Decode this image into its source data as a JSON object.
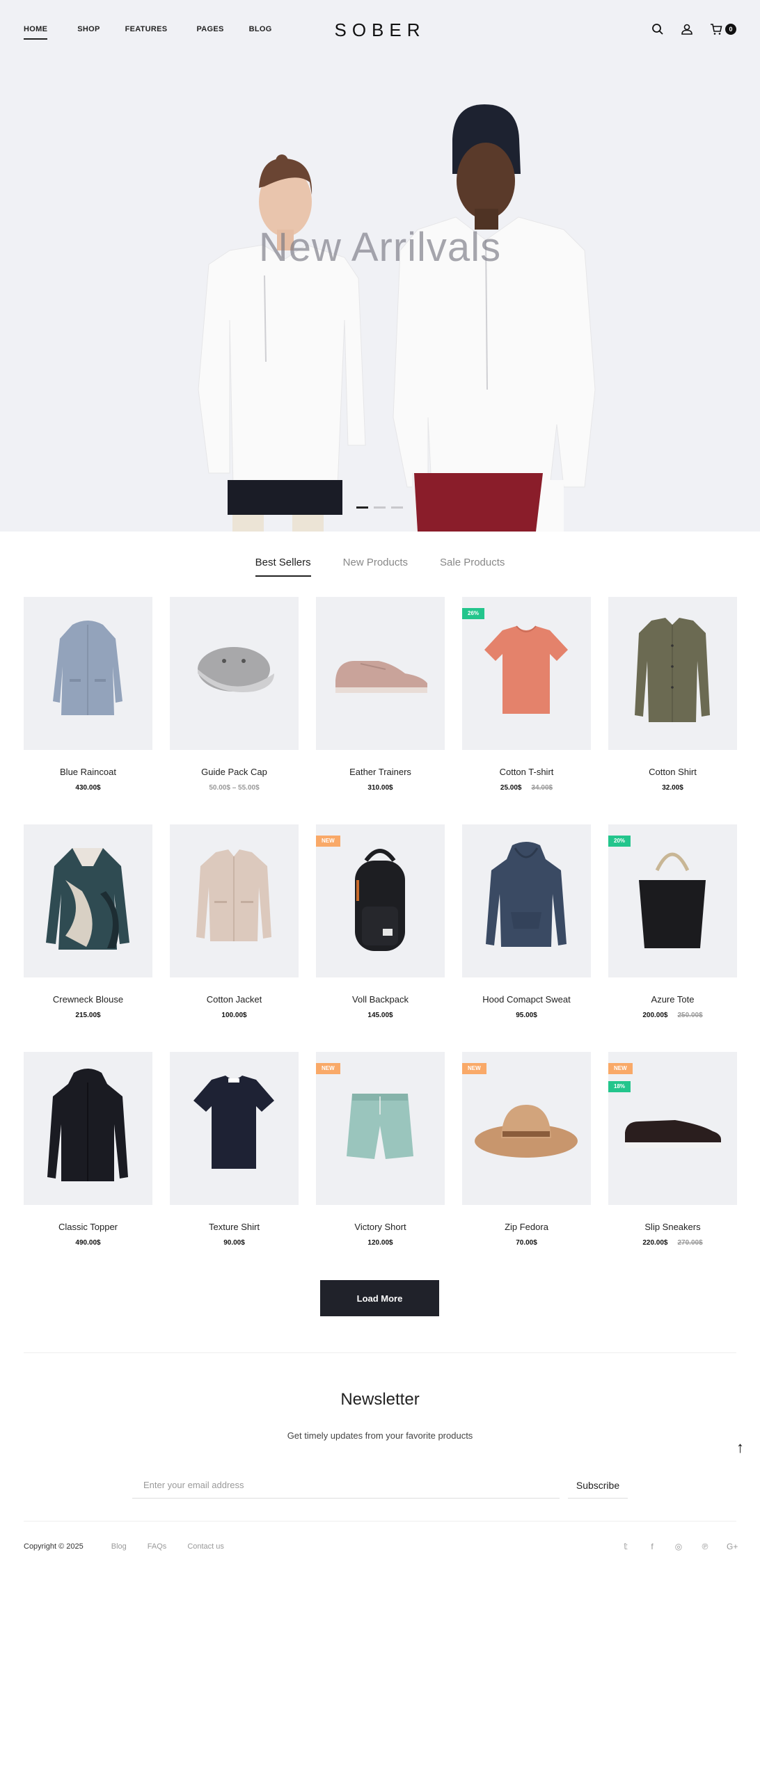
{
  "header": {
    "nav": [
      "HOME",
      "SHOP",
      "FEATURES",
      "PAGES",
      "BLOG"
    ],
    "logo": "SOBER",
    "cart_count": "0"
  },
  "hero": {
    "title": "New Arrilvals",
    "slides": 3,
    "active_slide": 1
  },
  "tabs": [
    "Best Sellers",
    "New Products",
    "Sale Products"
  ],
  "products": [
    {
      "name": "Blue Raincoat",
      "price": "430.00$",
      "icon": "raincoat"
    },
    {
      "name": "Guide Pack Cap",
      "price": "50.00$ – 55.00$",
      "icon": "cap"
    },
    {
      "name": "Eather Trainers",
      "price": "310.00$",
      "icon": "trainers"
    },
    {
      "name": "Cotton T-shirt",
      "price": "25.00$",
      "old_price": "34.00$",
      "badge": "26%",
      "icon": "tshirt"
    },
    {
      "name": "Cotton Shirt",
      "price": "32.00$",
      "icon": "shirt"
    },
    {
      "name": "Crewneck Blouse",
      "price": "215.00$",
      "icon": "blouse"
    },
    {
      "name": "Cotton Jacket",
      "price": "100.00$",
      "icon": "jacket"
    },
    {
      "name": "Voll Backpack",
      "price": "145.00$",
      "badge": "NEW",
      "icon": "backpack"
    },
    {
      "name": "Hood Comapct Sweat",
      "price": "95.00$",
      "icon": "hoodie"
    },
    {
      "name": "Azure Tote",
      "price": "200.00$",
      "old_price": "250.00$",
      "badge": "20%",
      "icon": "tote"
    },
    {
      "name": "Classic Topper",
      "price": "490.00$",
      "icon": "coat"
    },
    {
      "name": "Texture Shirt",
      "price": "90.00$",
      "icon": "tee-dark"
    },
    {
      "name": "Victory Short",
      "price": "120.00$",
      "badge": "NEW",
      "icon": "shorts"
    },
    {
      "name": "Zip Fedora",
      "price": "70.00$",
      "badge": "NEW",
      "icon": "fedora"
    },
    {
      "name": "Slip Sneakers",
      "price": "220.00$",
      "old_price": "270.00$",
      "badge": "NEW",
      "badge2": "18%",
      "icon": "sneakers"
    }
  ],
  "load_more": "Load More",
  "newsletter": {
    "title": "Newsletter",
    "subtitle": "Get timely updates from your favorite products",
    "placeholder": "Enter your email address",
    "button": "Subscribe"
  },
  "footer": {
    "copyright": "Copyright © 2025",
    "links": [
      "Blog",
      "FAQs",
      "Contact us"
    ],
    "social": [
      {
        "icon": "twitter-icon",
        "glyph": "𝕥"
      },
      {
        "icon": "facebook-icon",
        "glyph": "f"
      },
      {
        "icon": "instagram-icon",
        "glyph": "◎"
      },
      {
        "icon": "pinterest-icon",
        "glyph": "℗"
      },
      {
        "icon": "google-plus-icon",
        "glyph": "G+"
      }
    ]
  },
  "colors": {
    "accent_dark": "#20222a",
    "badge_new": "#f9a968",
    "badge_sale": "#23c58c",
    "hero_bg": "#f0f1f5",
    "thumb_bg": "#eff0f3"
  }
}
